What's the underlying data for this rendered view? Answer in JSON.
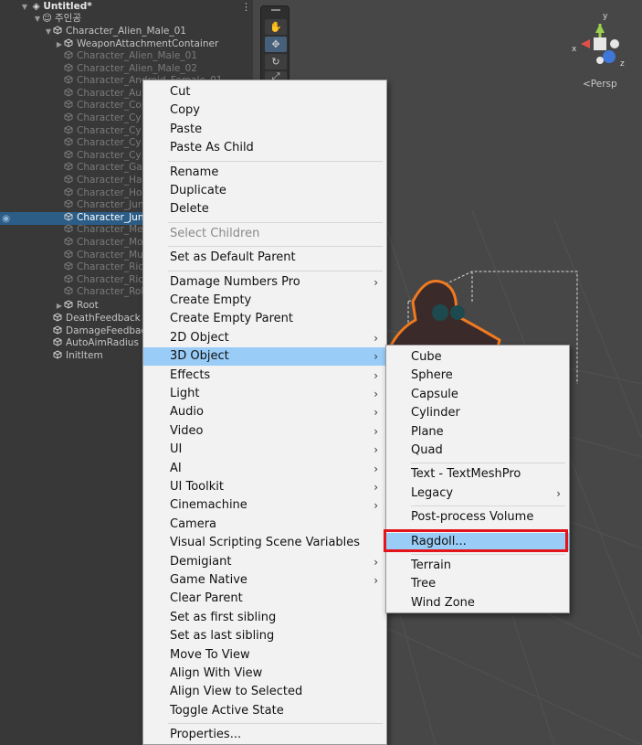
{
  "hierarchy": {
    "scene_title": "Untitled*",
    "items": [
      {
        "label": "주인공",
        "style": "normal"
      },
      {
        "label": "Character_Alien_Male_01",
        "style": "normal"
      },
      {
        "label": "WeaponAttachmentContainer",
        "style": "normal"
      },
      {
        "label": "Character_Alien_Male_01",
        "style": "dim"
      },
      {
        "label": "Character_Alien_Male_02",
        "style": "dim"
      },
      {
        "label": "Character_Android_Female_01",
        "style": "dim"
      },
      {
        "label": "Character_Au",
        "style": "dim"
      },
      {
        "label": "Character_Cop",
        "style": "dim"
      },
      {
        "label": "Character_Cy",
        "style": "dim"
      },
      {
        "label": "Character_Cy",
        "style": "dim"
      },
      {
        "label": "Character_Cy",
        "style": "dim"
      },
      {
        "label": "Character_Cy",
        "style": "dim"
      },
      {
        "label": "Character_Gar",
        "style": "dim"
      },
      {
        "label": "Character_Ha",
        "style": "dim"
      },
      {
        "label": "Character_Ho",
        "style": "dim"
      },
      {
        "label": "Character_Jun",
        "style": "dim"
      },
      {
        "label": "Character_Jun",
        "style": "selected"
      },
      {
        "label": "Character_Me",
        "style": "dim"
      },
      {
        "label": "Character_Mo",
        "style": "dim"
      },
      {
        "label": "Character_Mu",
        "style": "dim"
      },
      {
        "label": "Character_Ric",
        "style": "dim"
      },
      {
        "label": "Character_Ric",
        "style": "dim"
      },
      {
        "label": "Character_Rob",
        "style": "dim"
      },
      {
        "label": "Root",
        "style": "normal"
      },
      {
        "label": "DeathFeedback",
        "style": "normal"
      },
      {
        "label": "DamageFeedback",
        "style": "normal"
      },
      {
        "label": "AutoAimRadius",
        "style": "normal"
      },
      {
        "label": "InitItem",
        "style": "normal"
      }
    ]
  },
  "scene": {
    "persp_label": "<Persp",
    "gizmo": {
      "y": "y",
      "x": "x",
      "z": "z"
    },
    "tools": [
      "hand-icon",
      "move-icon",
      "rotate-icon",
      "scale-icon"
    ]
  },
  "context_menu": {
    "items": [
      {
        "label": "Cut"
      },
      {
        "label": "Copy"
      },
      {
        "label": "Paste"
      },
      {
        "label": "Paste As Child"
      },
      {
        "sep": true
      },
      {
        "label": "Rename"
      },
      {
        "label": "Duplicate"
      },
      {
        "label": "Delete"
      },
      {
        "sep": true
      },
      {
        "label": "Select Children",
        "disabled": true
      },
      {
        "sep": true
      },
      {
        "label": "Set as Default Parent"
      },
      {
        "sep": true
      },
      {
        "label": "Damage Numbers Pro",
        "submenu": true
      },
      {
        "label": "Create Empty"
      },
      {
        "label": "Create Empty Parent"
      },
      {
        "label": "2D Object",
        "submenu": true
      },
      {
        "label": "3D Object",
        "submenu": true,
        "highlighted": true
      },
      {
        "label": "Effects",
        "submenu": true
      },
      {
        "label": "Light",
        "submenu": true
      },
      {
        "label": "Audio",
        "submenu": true
      },
      {
        "label": "Video",
        "submenu": true
      },
      {
        "label": "UI",
        "submenu": true
      },
      {
        "label": "AI",
        "submenu": true
      },
      {
        "label": "UI Toolkit",
        "submenu": true
      },
      {
        "label": "Cinemachine",
        "submenu": true
      },
      {
        "label": "Camera"
      },
      {
        "label": "Visual Scripting Scene Variables"
      },
      {
        "label": "Demigiant",
        "submenu": true
      },
      {
        "label": "Game Native",
        "submenu": true
      },
      {
        "label": "Clear Parent"
      },
      {
        "label": "Set as first sibling"
      },
      {
        "label": "Set as last sibling"
      },
      {
        "label": "Move To View"
      },
      {
        "label": "Align With View"
      },
      {
        "label": "Align View to Selected"
      },
      {
        "label": "Toggle Active State"
      },
      {
        "sep": true
      },
      {
        "label": "Properties..."
      }
    ]
  },
  "submenu_3d": {
    "items": [
      {
        "label": "Cube"
      },
      {
        "label": "Sphere"
      },
      {
        "label": "Capsule"
      },
      {
        "label": "Cylinder"
      },
      {
        "label": "Plane"
      },
      {
        "label": "Quad"
      },
      {
        "sep": true
      },
      {
        "label": "Text - TextMeshPro"
      },
      {
        "label": "Legacy",
        "submenu": true
      },
      {
        "sep": true
      },
      {
        "label": "Post-process Volume"
      },
      {
        "sep": true
      },
      {
        "label": "Ragdoll...",
        "highlighted": true
      },
      {
        "sep": true
      },
      {
        "label": "Terrain"
      },
      {
        "label": "Tree"
      },
      {
        "label": "Wind Zone"
      }
    ]
  },
  "colors": {
    "highlight": "#99ccf7",
    "annotation_box": "#e3141b",
    "selection": "#2c5d87"
  }
}
